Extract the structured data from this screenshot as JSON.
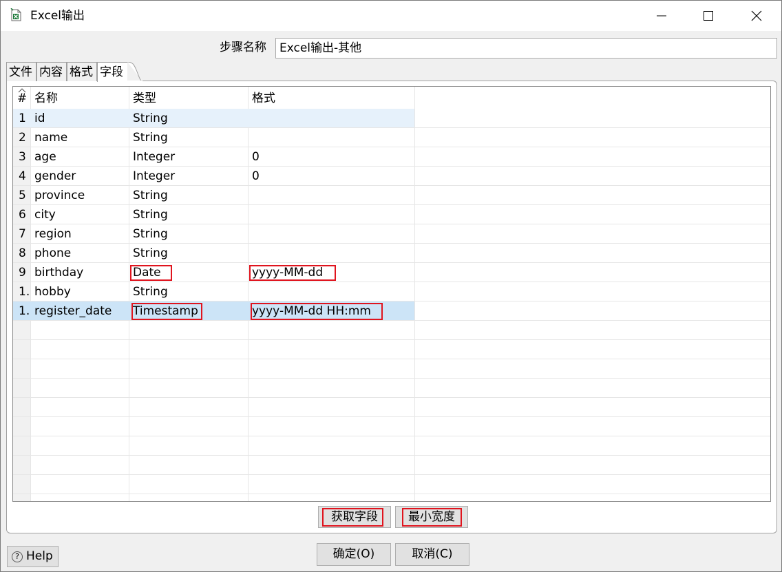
{
  "window": {
    "title": "Excel输出",
    "icon": "excel-file-icon"
  },
  "step": {
    "label": "步骤名称",
    "value": "Excel输出-其他"
  },
  "tabs": [
    {
      "label": "文件"
    },
    {
      "label": "内容"
    },
    {
      "label": "格式"
    },
    {
      "label": "字段"
    }
  ],
  "active_tab": "字段",
  "table": {
    "headers": {
      "num": "#",
      "name": "名称",
      "type": "类型",
      "format": "格式"
    },
    "rows": [
      {
        "num": "1",
        "name": "id",
        "type": "String",
        "format": ""
      },
      {
        "num": "2",
        "name": "name",
        "type": "String",
        "format": ""
      },
      {
        "num": "3",
        "name": "age",
        "type": "Integer",
        "format": "0"
      },
      {
        "num": "4",
        "name": "gender",
        "type": "Integer",
        "format": "0"
      },
      {
        "num": "5",
        "name": "province",
        "type": "String",
        "format": ""
      },
      {
        "num": "6",
        "name": "city",
        "type": "String",
        "format": ""
      },
      {
        "num": "7",
        "name": "region",
        "type": "String",
        "format": ""
      },
      {
        "num": "8",
        "name": "phone",
        "type": "String",
        "format": ""
      },
      {
        "num": "9",
        "name": "birthday",
        "type": "Date",
        "format": "yyyy-MM-dd"
      },
      {
        "num": "1.",
        "name": "hobby",
        "type": "String",
        "format": ""
      },
      {
        "num": "1.",
        "name": "register_date",
        "type": "Timestamp",
        "format": "yyyy-MM-dd HH:mm"
      }
    ]
  },
  "buttons": {
    "get_fields": "获取字段",
    "min_width": "最小宽度",
    "ok": "确定(O)",
    "cancel": "取消(C)",
    "help": "Help"
  },
  "colors": {
    "highlight_box": "#e0141e",
    "selected_row": "#cce4f7",
    "hover_row": "#e6f1fb"
  }
}
